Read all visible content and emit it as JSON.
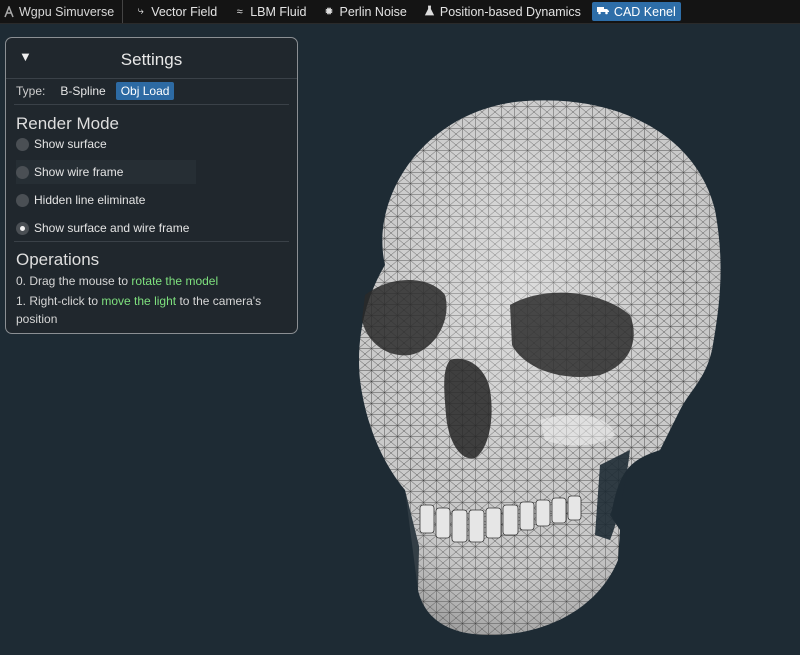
{
  "menubar": {
    "app_title": "Wgpu Simuverse",
    "items": [
      {
        "label": "Vector Field",
        "icon": "vector-field-icon"
      },
      {
        "label": "LBM Fluid",
        "icon": "fluid-icon"
      },
      {
        "label": "Perlin Noise",
        "icon": "noise-icon"
      },
      {
        "label": "Position-based Dynamics",
        "icon": "flask-icon"
      },
      {
        "label": "CAD Kenel",
        "icon": "truck-icon"
      }
    ],
    "active_index": 4
  },
  "settings": {
    "title": "Settings",
    "type_label": "Type:",
    "type_options": [
      "B-Spline",
      "Obj Load"
    ],
    "type_selected": "Obj Load",
    "render_mode_title": "Render Mode",
    "render_modes": [
      "Show surface",
      "Show wire frame",
      "Hidden line eliminate",
      "Show surface and wire frame"
    ],
    "render_mode_selected": "Show surface and wire frame",
    "operations_title": "Operations",
    "operations": [
      {
        "prefix": "0. Drag the mouse to",
        "highlight": "rotate the model",
        "suffix": ""
      },
      {
        "prefix": "1. Right-click to",
        "highlight": "move the light",
        "suffix": "to the camera's position"
      }
    ]
  },
  "colors": {
    "background": "#1e2b34",
    "menubar": "#141414",
    "accent": "#2e6ea8",
    "highlight_text": "#7ee07e",
    "panel": "#20272d"
  },
  "scene": {
    "model": "skull-mesh"
  }
}
